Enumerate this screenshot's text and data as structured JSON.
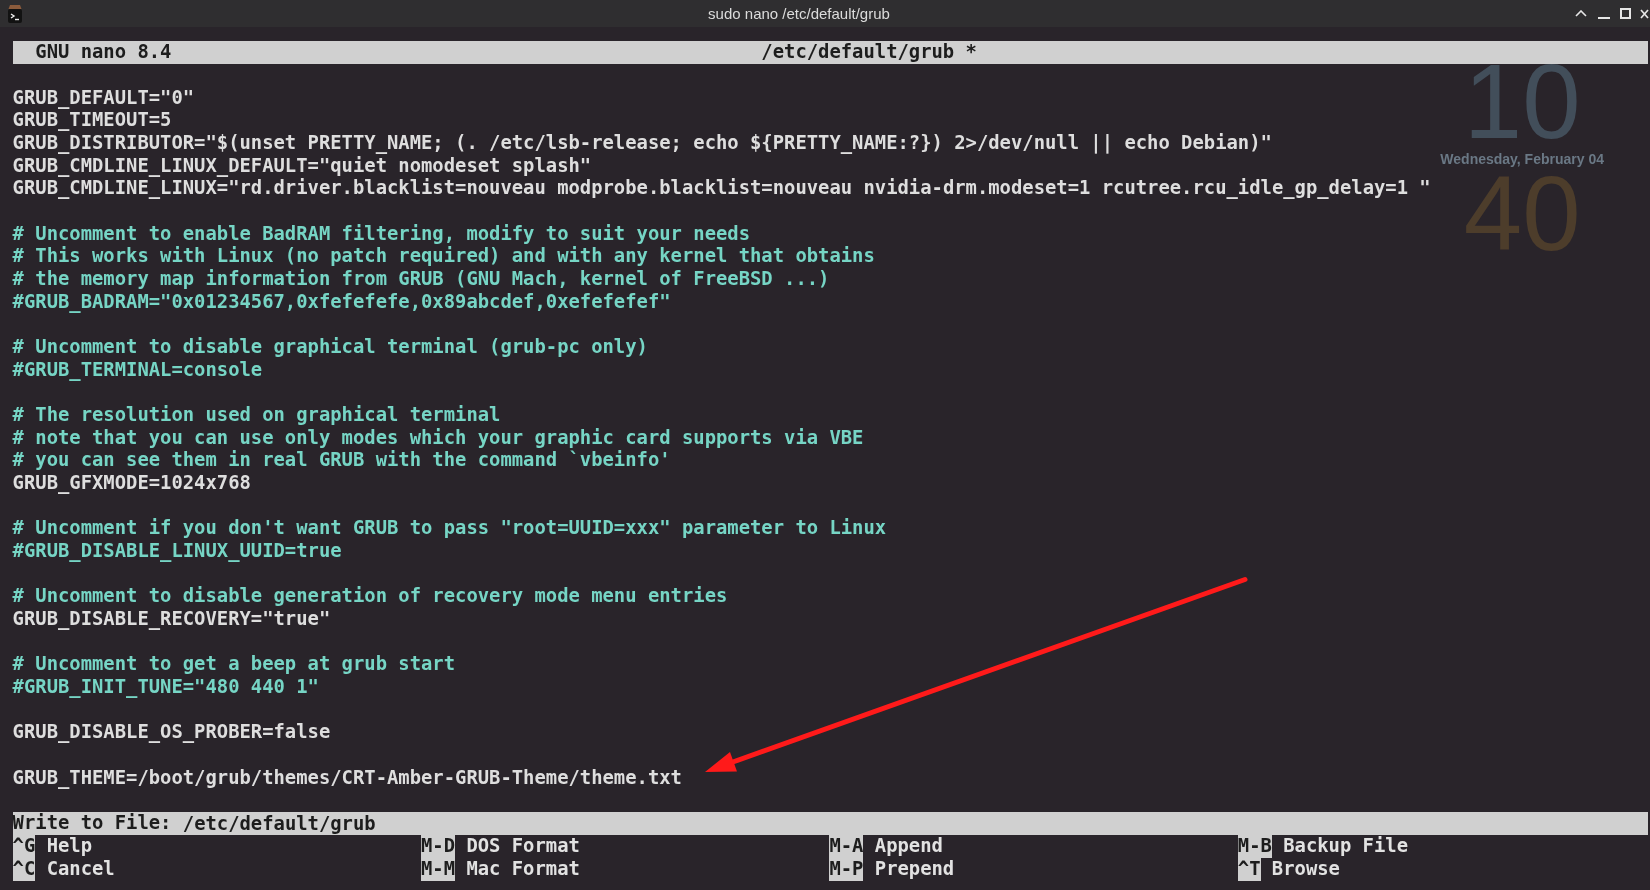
{
  "window": {
    "title": "sudo nano /etc/default/grub"
  },
  "desktop_clock": {
    "hour": "10",
    "date": "Wednesday, February 04",
    "minute": "40"
  },
  "nano": {
    "version": "GNU nano 8.4",
    "file_title": "/etc/default/grub *"
  },
  "lines": [
    {
      "kind": "setting",
      "text": "GRUB_DEFAULT=\"0\""
    },
    {
      "kind": "setting",
      "text": "GRUB_TIMEOUT=5"
    },
    {
      "kind": "setting",
      "text": "GRUB_DISTRIBUTOR=\"$(unset PRETTY_NAME; (. /etc/lsb-release; echo ${PRETTY_NAME:?}) 2>/dev/null || echo Debian)\""
    },
    {
      "kind": "setting",
      "text": "GRUB_CMDLINE_LINUX_DEFAULT=\"quiet nomodeset splash\""
    },
    {
      "kind": "setting",
      "text": "GRUB_CMDLINE_LINUX=\"rd.driver.blacklist=nouveau modprobe.blacklist=nouveau nvidia-drm.modeset=1 rcutree.rcu_idle_gp_delay=1 \""
    },
    {
      "kind": "blank"
    },
    {
      "kind": "comment",
      "text": "# Uncomment to enable BadRAM filtering, modify to suit your needs"
    },
    {
      "kind": "comment",
      "text": "# This works with Linux (no patch required) and with any kernel that obtains"
    },
    {
      "kind": "comment",
      "text": "# the memory map information from GRUB (GNU Mach, kernel of FreeBSD ...)"
    },
    {
      "kind": "comment",
      "text": "#GRUB_BADRAM=\"0x01234567,0xfefefefe,0x89abcdef,0xefefefef\""
    },
    {
      "kind": "blank"
    },
    {
      "kind": "comment",
      "text": "# Uncomment to disable graphical terminal (grub-pc only)"
    },
    {
      "kind": "comment",
      "text": "#GRUB_TERMINAL=console"
    },
    {
      "kind": "blank"
    },
    {
      "kind": "comment",
      "text": "# The resolution used on graphical terminal"
    },
    {
      "kind": "comment",
      "text": "# note that you can use only modes which your graphic card supports via VBE"
    },
    {
      "kind": "comment",
      "text": "# you can see them in real GRUB with the command `vbeinfo'"
    },
    {
      "kind": "setting",
      "text": "GRUB_GFXMODE=1024x768"
    },
    {
      "kind": "blank"
    },
    {
      "kind": "comment",
      "text": "# Uncomment if you don't want GRUB to pass \"root=UUID=xxx\" parameter to Linux"
    },
    {
      "kind": "comment",
      "text": "#GRUB_DISABLE_LINUX_UUID=true"
    },
    {
      "kind": "blank"
    },
    {
      "kind": "comment",
      "text": "# Uncomment to disable generation of recovery mode menu entries"
    },
    {
      "kind": "setting",
      "text": "GRUB_DISABLE_RECOVERY=\"true\""
    },
    {
      "kind": "blank"
    },
    {
      "kind": "comment",
      "text": "# Uncomment to get a beep at grub start"
    },
    {
      "kind": "comment",
      "text": "#GRUB_INIT_TUNE=\"480 440 1\""
    },
    {
      "kind": "blank"
    },
    {
      "kind": "setting",
      "text": "GRUB_DISABLE_OS_PROBER=false"
    },
    {
      "kind": "blank"
    },
    {
      "kind": "setting",
      "text": "GRUB_THEME=/boot/grub/themes/CRT-Amber-GRUB-Theme/theme.txt"
    }
  ],
  "prompt": {
    "label": "Write to File:",
    "value": "/etc/default/grub"
  },
  "shortcuts": [
    {
      "key": "^G",
      "label": "Help"
    },
    {
      "key": "M-D",
      "label": "DOS Format"
    },
    {
      "key": "M-A",
      "label": "Append"
    },
    {
      "key": "M-B",
      "label": "Backup File"
    },
    {
      "key": "^C",
      "label": "Cancel"
    },
    {
      "key": "M-M",
      "label": "Mac Format"
    },
    {
      "key": "M-P",
      "label": "Prepend"
    },
    {
      "key": "^T",
      "label": "Browse"
    }
  ]
}
